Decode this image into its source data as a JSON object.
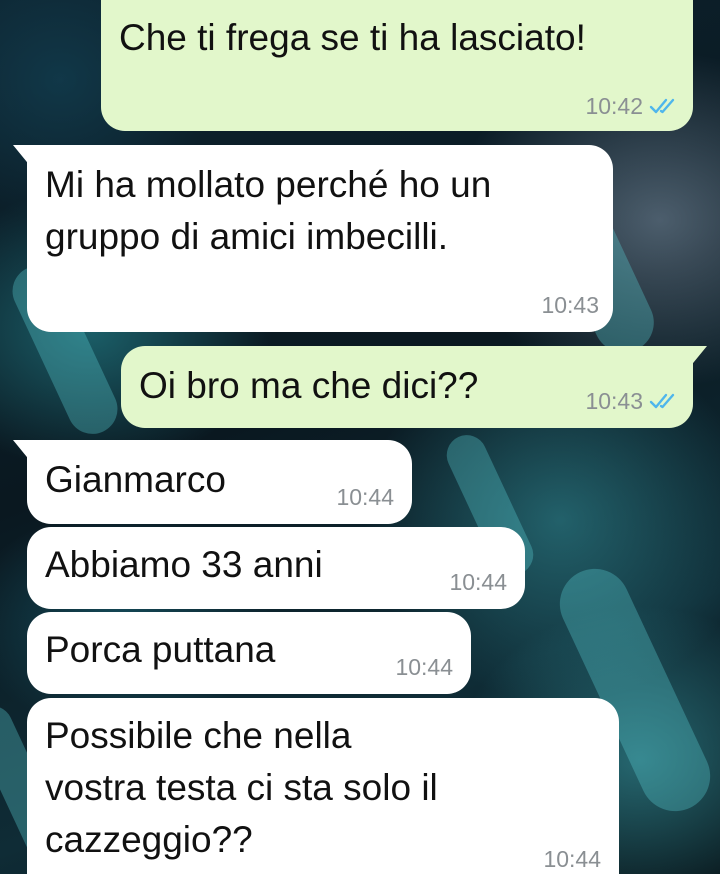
{
  "messages": [
    {
      "direction": "out",
      "text": "Che ti frega se ti ha lasciato!",
      "time": "10:42",
      "status": "read"
    },
    {
      "direction": "in",
      "lines": [
        "Mi ha mollato perché ho un",
        "gruppo di amici imbecilli."
      ],
      "time": "10:43"
    },
    {
      "direction": "out",
      "text": "Oi bro ma che dici??",
      "time": "10:43",
      "status": "read"
    },
    {
      "direction": "in",
      "text": "Gianmarco",
      "time": "10:44"
    },
    {
      "direction": "in",
      "text": "Abbiamo 33 anni",
      "time": "10:44"
    },
    {
      "direction": "in",
      "text": "Porca puttana",
      "time": "10:44"
    },
    {
      "direction": "in",
      "lines": [
        "Possibile che nella",
        "vostra testa ci sta solo il",
        "cazzeggio??"
      ],
      "time": "10:44"
    }
  ],
  "colors": {
    "outgoing_bubble": "#e2f7cb",
    "incoming_bubble": "#ffffff",
    "read_ticks": "#4fb6ec",
    "timestamp": "#8a8f93"
  },
  "icons": {
    "read_status": "double-check-icon"
  }
}
